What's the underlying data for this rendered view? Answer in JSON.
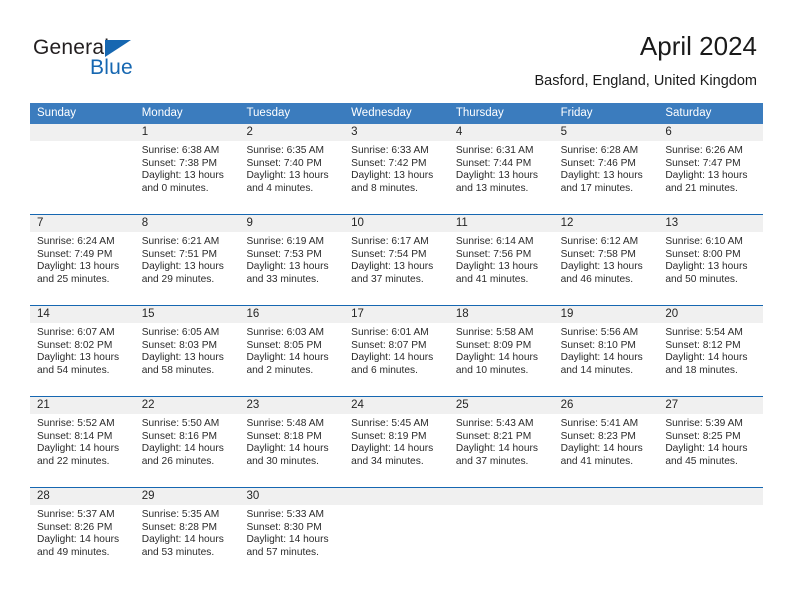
{
  "logo": {
    "primary_text": "General",
    "secondary_text": "Blue",
    "triangle_icon": "blue-triangle-icon",
    "primary_color": "#231f20",
    "secondary_color": "#1667b1"
  },
  "header": {
    "title": "April 2024",
    "subtitle": "Basford, England, United Kingdom"
  },
  "theme": {
    "header_blue": "#3b7cbe",
    "row_border_blue": "#1667b1",
    "day_band_gray": "#f0f0f0"
  },
  "weekdays": [
    "Sunday",
    "Monday",
    "Tuesday",
    "Wednesday",
    "Thursday",
    "Friday",
    "Saturday"
  ],
  "weeks": [
    [
      {
        "day": "",
        "sunrise": "",
        "sunset": "",
        "daylight_line1": "",
        "daylight_line2": ""
      },
      {
        "day": "1",
        "sunrise": "Sunrise: 6:38 AM",
        "sunset": "Sunset: 7:38 PM",
        "daylight_line1": "Daylight: 13 hours",
        "daylight_line2": "and 0 minutes."
      },
      {
        "day": "2",
        "sunrise": "Sunrise: 6:35 AM",
        "sunset": "Sunset: 7:40 PM",
        "daylight_line1": "Daylight: 13 hours",
        "daylight_line2": "and 4 minutes."
      },
      {
        "day": "3",
        "sunrise": "Sunrise: 6:33 AM",
        "sunset": "Sunset: 7:42 PM",
        "daylight_line1": "Daylight: 13 hours",
        "daylight_line2": "and 8 minutes."
      },
      {
        "day": "4",
        "sunrise": "Sunrise: 6:31 AM",
        "sunset": "Sunset: 7:44 PM",
        "daylight_line1": "Daylight: 13 hours",
        "daylight_line2": "and 13 minutes."
      },
      {
        "day": "5",
        "sunrise": "Sunrise: 6:28 AM",
        "sunset": "Sunset: 7:46 PM",
        "daylight_line1": "Daylight: 13 hours",
        "daylight_line2": "and 17 minutes."
      },
      {
        "day": "6",
        "sunrise": "Sunrise: 6:26 AM",
        "sunset": "Sunset: 7:47 PM",
        "daylight_line1": "Daylight: 13 hours",
        "daylight_line2": "and 21 minutes."
      }
    ],
    [
      {
        "day": "7",
        "sunrise": "Sunrise: 6:24 AM",
        "sunset": "Sunset: 7:49 PM",
        "daylight_line1": "Daylight: 13 hours",
        "daylight_line2": "and 25 minutes."
      },
      {
        "day": "8",
        "sunrise": "Sunrise: 6:21 AM",
        "sunset": "Sunset: 7:51 PM",
        "daylight_line1": "Daylight: 13 hours",
        "daylight_line2": "and 29 minutes."
      },
      {
        "day": "9",
        "sunrise": "Sunrise: 6:19 AM",
        "sunset": "Sunset: 7:53 PM",
        "daylight_line1": "Daylight: 13 hours",
        "daylight_line2": "and 33 minutes."
      },
      {
        "day": "10",
        "sunrise": "Sunrise: 6:17 AM",
        "sunset": "Sunset: 7:54 PM",
        "daylight_line1": "Daylight: 13 hours",
        "daylight_line2": "and 37 minutes."
      },
      {
        "day": "11",
        "sunrise": "Sunrise: 6:14 AM",
        "sunset": "Sunset: 7:56 PM",
        "daylight_line1": "Daylight: 13 hours",
        "daylight_line2": "and 41 minutes."
      },
      {
        "day": "12",
        "sunrise": "Sunrise: 6:12 AM",
        "sunset": "Sunset: 7:58 PM",
        "daylight_line1": "Daylight: 13 hours",
        "daylight_line2": "and 46 minutes."
      },
      {
        "day": "13",
        "sunrise": "Sunrise: 6:10 AM",
        "sunset": "Sunset: 8:00 PM",
        "daylight_line1": "Daylight: 13 hours",
        "daylight_line2": "and 50 minutes."
      }
    ],
    [
      {
        "day": "14",
        "sunrise": "Sunrise: 6:07 AM",
        "sunset": "Sunset: 8:02 PM",
        "daylight_line1": "Daylight: 13 hours",
        "daylight_line2": "and 54 minutes."
      },
      {
        "day": "15",
        "sunrise": "Sunrise: 6:05 AM",
        "sunset": "Sunset: 8:03 PM",
        "daylight_line1": "Daylight: 13 hours",
        "daylight_line2": "and 58 minutes."
      },
      {
        "day": "16",
        "sunrise": "Sunrise: 6:03 AM",
        "sunset": "Sunset: 8:05 PM",
        "daylight_line1": "Daylight: 14 hours",
        "daylight_line2": "and 2 minutes."
      },
      {
        "day": "17",
        "sunrise": "Sunrise: 6:01 AM",
        "sunset": "Sunset: 8:07 PM",
        "daylight_line1": "Daylight: 14 hours",
        "daylight_line2": "and 6 minutes."
      },
      {
        "day": "18",
        "sunrise": "Sunrise: 5:58 AM",
        "sunset": "Sunset: 8:09 PM",
        "daylight_line1": "Daylight: 14 hours",
        "daylight_line2": "and 10 minutes."
      },
      {
        "day": "19",
        "sunrise": "Sunrise: 5:56 AM",
        "sunset": "Sunset: 8:10 PM",
        "daylight_line1": "Daylight: 14 hours",
        "daylight_line2": "and 14 minutes."
      },
      {
        "day": "20",
        "sunrise": "Sunrise: 5:54 AM",
        "sunset": "Sunset: 8:12 PM",
        "daylight_line1": "Daylight: 14 hours",
        "daylight_line2": "and 18 minutes."
      }
    ],
    [
      {
        "day": "21",
        "sunrise": "Sunrise: 5:52 AM",
        "sunset": "Sunset: 8:14 PM",
        "daylight_line1": "Daylight: 14 hours",
        "daylight_line2": "and 22 minutes."
      },
      {
        "day": "22",
        "sunrise": "Sunrise: 5:50 AM",
        "sunset": "Sunset: 8:16 PM",
        "daylight_line1": "Daylight: 14 hours",
        "daylight_line2": "and 26 minutes."
      },
      {
        "day": "23",
        "sunrise": "Sunrise: 5:48 AM",
        "sunset": "Sunset: 8:18 PM",
        "daylight_line1": "Daylight: 14 hours",
        "daylight_line2": "and 30 minutes."
      },
      {
        "day": "24",
        "sunrise": "Sunrise: 5:45 AM",
        "sunset": "Sunset: 8:19 PM",
        "daylight_line1": "Daylight: 14 hours",
        "daylight_line2": "and 34 minutes."
      },
      {
        "day": "25",
        "sunrise": "Sunrise: 5:43 AM",
        "sunset": "Sunset: 8:21 PM",
        "daylight_line1": "Daylight: 14 hours",
        "daylight_line2": "and 37 minutes."
      },
      {
        "day": "26",
        "sunrise": "Sunrise: 5:41 AM",
        "sunset": "Sunset: 8:23 PM",
        "daylight_line1": "Daylight: 14 hours",
        "daylight_line2": "and 41 minutes."
      },
      {
        "day": "27",
        "sunrise": "Sunrise: 5:39 AM",
        "sunset": "Sunset: 8:25 PM",
        "daylight_line1": "Daylight: 14 hours",
        "daylight_line2": "and 45 minutes."
      }
    ],
    [
      {
        "day": "28",
        "sunrise": "Sunrise: 5:37 AM",
        "sunset": "Sunset: 8:26 PM",
        "daylight_line1": "Daylight: 14 hours",
        "daylight_line2": "and 49 minutes."
      },
      {
        "day": "29",
        "sunrise": "Sunrise: 5:35 AM",
        "sunset": "Sunset: 8:28 PM",
        "daylight_line1": "Daylight: 14 hours",
        "daylight_line2": "and 53 minutes."
      },
      {
        "day": "30",
        "sunrise": "Sunrise: 5:33 AM",
        "sunset": "Sunset: 8:30 PM",
        "daylight_line1": "Daylight: 14 hours",
        "daylight_line2": "and 57 minutes."
      },
      {
        "day": "",
        "sunrise": "",
        "sunset": "",
        "daylight_line1": "",
        "daylight_line2": ""
      },
      {
        "day": "",
        "sunrise": "",
        "sunset": "",
        "daylight_line1": "",
        "daylight_line2": ""
      },
      {
        "day": "",
        "sunrise": "",
        "sunset": "",
        "daylight_line1": "",
        "daylight_line2": ""
      },
      {
        "day": "",
        "sunrise": "",
        "sunset": "",
        "daylight_line1": "",
        "daylight_line2": ""
      }
    ]
  ]
}
